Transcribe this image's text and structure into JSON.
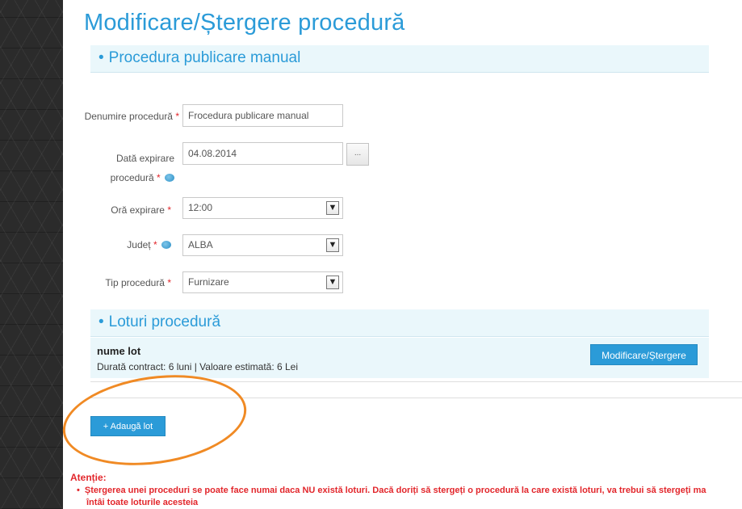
{
  "page_title": "Modificare/Ștergere procedură",
  "section_procedure": {
    "bullet": "•",
    "title": "Procedura publicare manual"
  },
  "form": {
    "name_label": "Denumire procedură",
    "name_value": "Frocedura publicare manual",
    "expiry_date_label_1": "Dată expirare",
    "expiry_date_label_2": "procedură",
    "expiry_date_value": "04.08.2014",
    "date_picker_label": "...",
    "expiry_hour_label": "Oră expirare",
    "expiry_hour_value": "12:00",
    "county_label": "Județ",
    "county_value": "ALBA",
    "type_label": "Tip procedură",
    "type_value": "Furnizare",
    "required_marker": "*"
  },
  "section_lots": {
    "bullet": "•",
    "title": "Loturi procedură"
  },
  "lot": {
    "name": "nume lot",
    "details": "Durată contract: 6 luni | Valoare estimată: 6 Lei",
    "modify_button": "Modificare/Ștergere"
  },
  "add_lot_button": "+ Adaugă lot",
  "warning": {
    "title": "Atenție:",
    "bullet": "•",
    "line1": "Ștergerea unei proceduri se poate face numai daca NU există loturi. Dacă doriți să stergeți o procedură la care există loturi, va trebui să stergeți ma",
    "line2": "întâi toate loturile acesteia"
  },
  "colors": {
    "accent": "#2b9bd8",
    "required": "#e2262b",
    "highlight": "#f08a24"
  }
}
